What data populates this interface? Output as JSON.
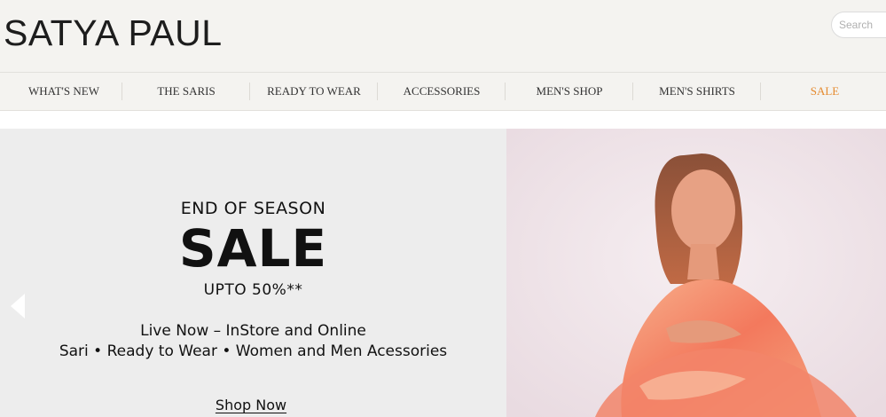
{
  "header": {
    "logo": "SATYA PAUL",
    "search_placeholder": "Search"
  },
  "nav": {
    "items": [
      {
        "label": "WHAT'S NEW"
      },
      {
        "label": "THE SARIS"
      },
      {
        "label": "READY TO WEAR"
      },
      {
        "label": "ACCESSORIES"
      },
      {
        "label": "MEN'S SHOP"
      },
      {
        "label": "MEN'S SHIRTS"
      },
      {
        "label": "SALE"
      }
    ],
    "sale_color": "#e58a2e"
  },
  "hero": {
    "line1": "END OF SEASON",
    "line2": "SALE",
    "line3": "UPTO 50%**",
    "line4": "Live Now – InStore and Online",
    "line5": "Sari • Ready to Wear • Women and Men Acessories",
    "cta": "Shop Now",
    "prev_icon": "chevron-left-icon"
  }
}
